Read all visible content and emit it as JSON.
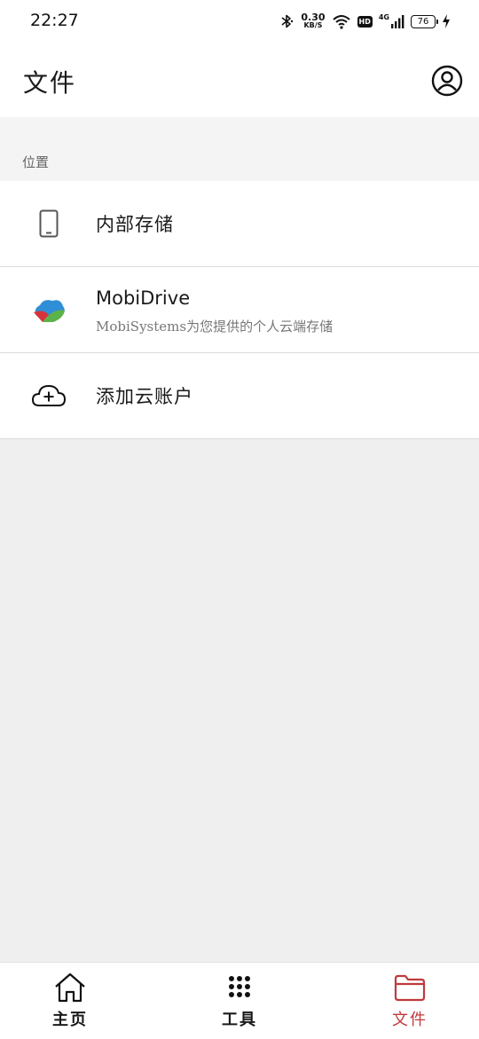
{
  "status_bar": {
    "time": "22:27",
    "net_speed_value": "0.30",
    "net_speed_unit": "KB/S",
    "hd_label": "HD",
    "network_label": "4G",
    "battery_level": "76",
    "icons": [
      "bluetooth-icon",
      "wifi-icon",
      "signal-icon",
      "charging-icon"
    ]
  },
  "header": {
    "title": "文件",
    "account_icon": "account-circle-icon"
  },
  "locations": {
    "section_label": "位置",
    "items": [
      {
        "label": "内部存储",
        "icon": "phone-icon"
      },
      {
        "title": "MobiDrive",
        "subtitle": "MobiSystems为您提供的个人云端存储",
        "icon": "mobidrive-logo-icon"
      },
      {
        "label": "添加云账户",
        "icon": "cloud-add-icon"
      }
    ]
  },
  "bottom_nav": {
    "active": "文件",
    "active_color": "#c0393b",
    "items": [
      {
        "label": "主页",
        "icon": "home-icon"
      },
      {
        "label": "工具",
        "icon": "grid-dots-icon"
      },
      {
        "label": "文件",
        "icon": "folder-icon"
      }
    ]
  }
}
